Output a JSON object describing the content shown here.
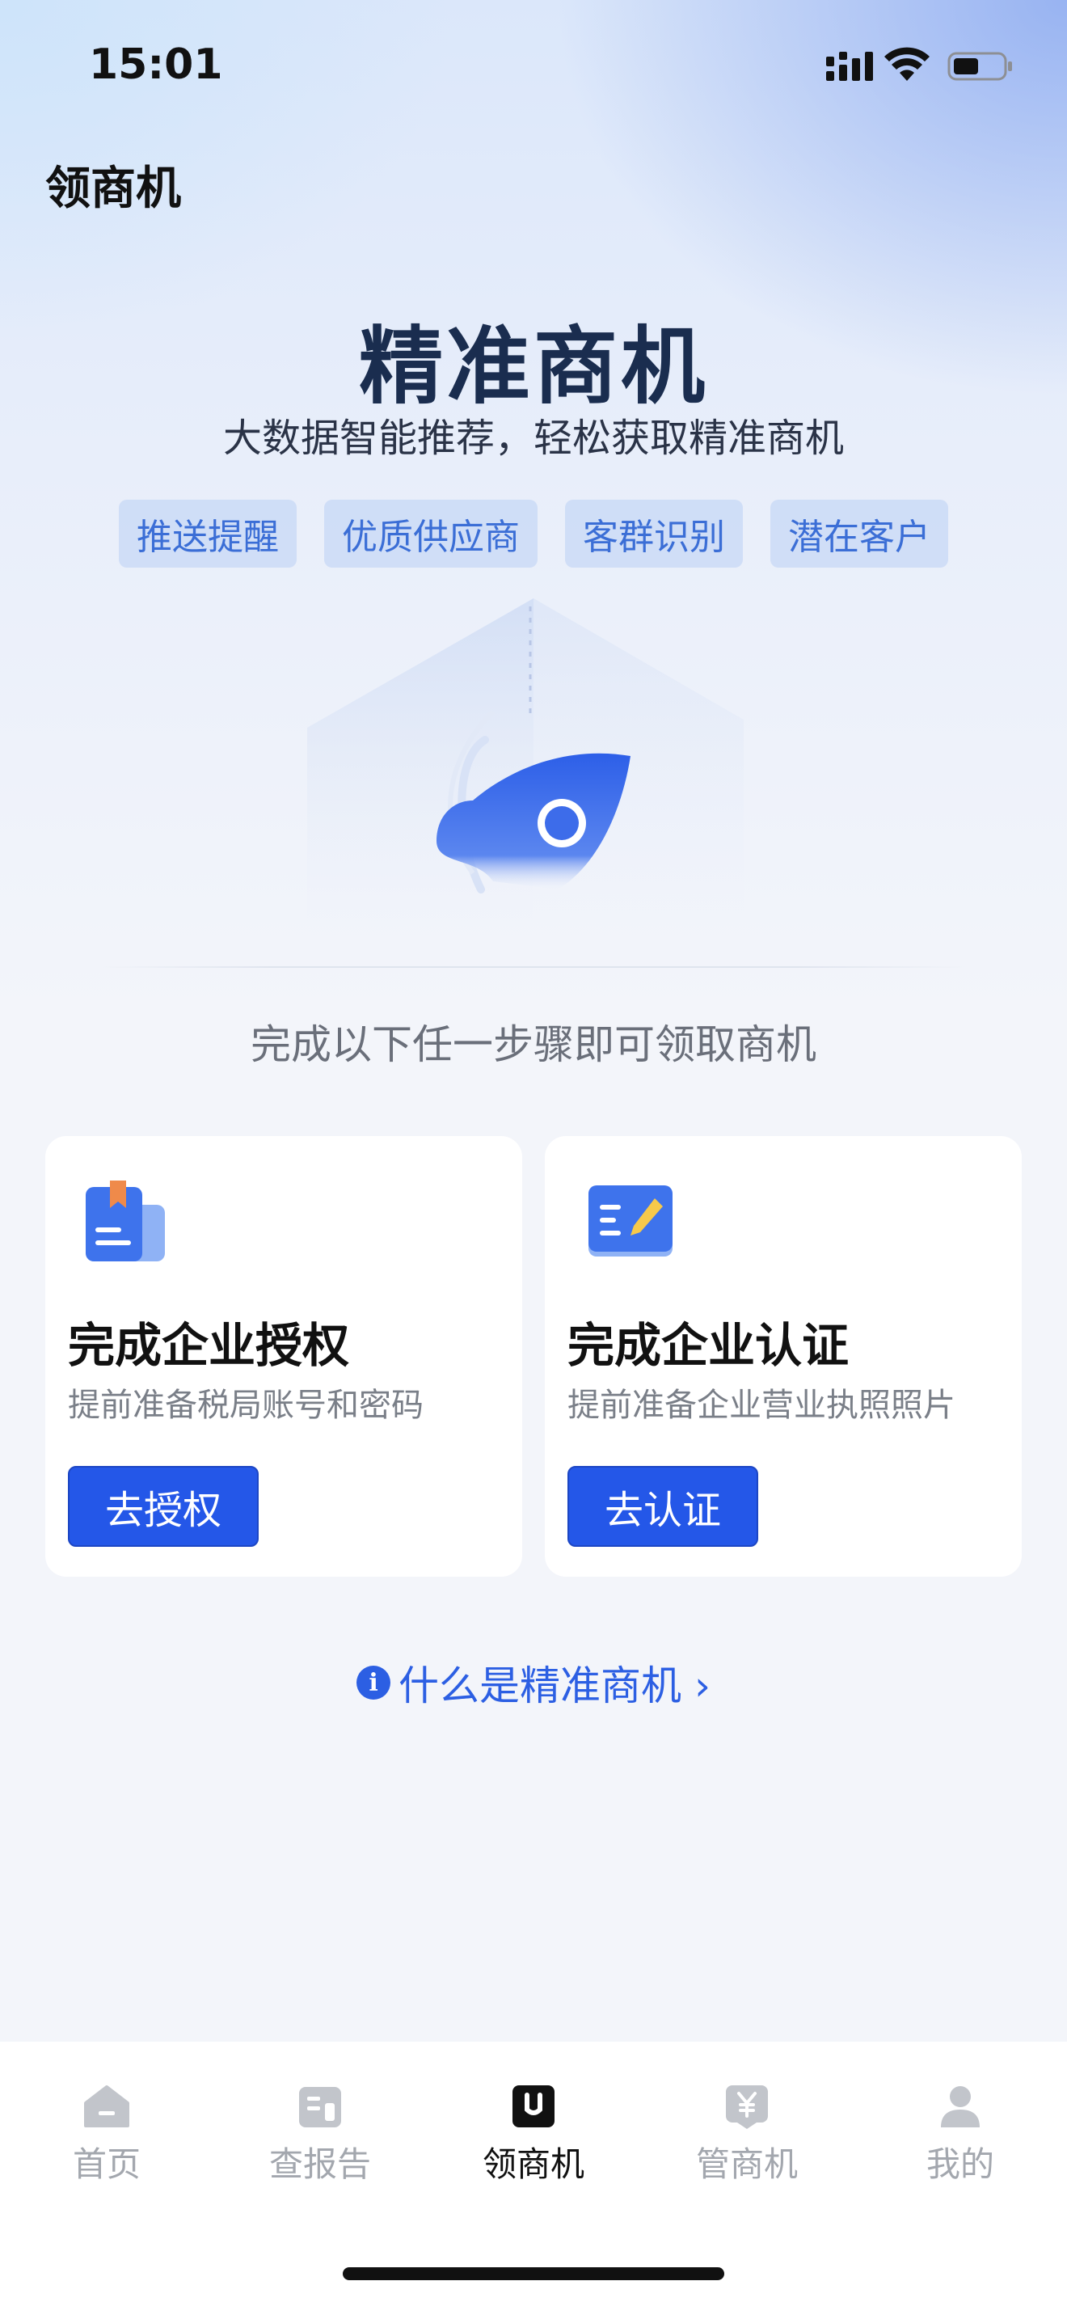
{
  "status_bar": {
    "time": "15:01",
    "icons": [
      "signal-icon",
      "wifi-icon",
      "battery-icon"
    ]
  },
  "nav": {
    "title": "领商机"
  },
  "hero": {
    "title": "精准商机",
    "subtitle": "大数据智能推荐，轻松获取精准商机",
    "tags": [
      "推送提醒",
      "优质供应商",
      "客群识别",
      "潜在客户"
    ]
  },
  "steps_hint": "完成以下任一步骤即可领取商机",
  "cards": [
    {
      "icon": "folder-document-icon",
      "title": "完成企业授权",
      "desc": "提前准备税局账号和密码",
      "button": "去授权"
    },
    {
      "icon": "book-pen-icon",
      "title": "完成企业认证",
      "desc": "提前准备企业营业执照照片",
      "button": "去认证"
    }
  ],
  "info_link": "什么是精准商机 ›",
  "tabs": [
    {
      "label": "首页",
      "icon": "home-icon",
      "active": false
    },
    {
      "label": "查报告",
      "icon": "report-icon",
      "active": false
    },
    {
      "label": "领商机",
      "icon": "opportunity-icon",
      "active": true
    },
    {
      "label": "管商机",
      "icon": "yen-manage-icon",
      "active": false
    },
    {
      "label": "我的",
      "icon": "user-icon",
      "active": false
    }
  ],
  "colors": {
    "primary": "#2457e8",
    "link": "#2c5fe3",
    "tag_text": "#3b6ed6",
    "hero_title": "#1a2d4f",
    "inactive_tab": "#a3a7ae"
  }
}
